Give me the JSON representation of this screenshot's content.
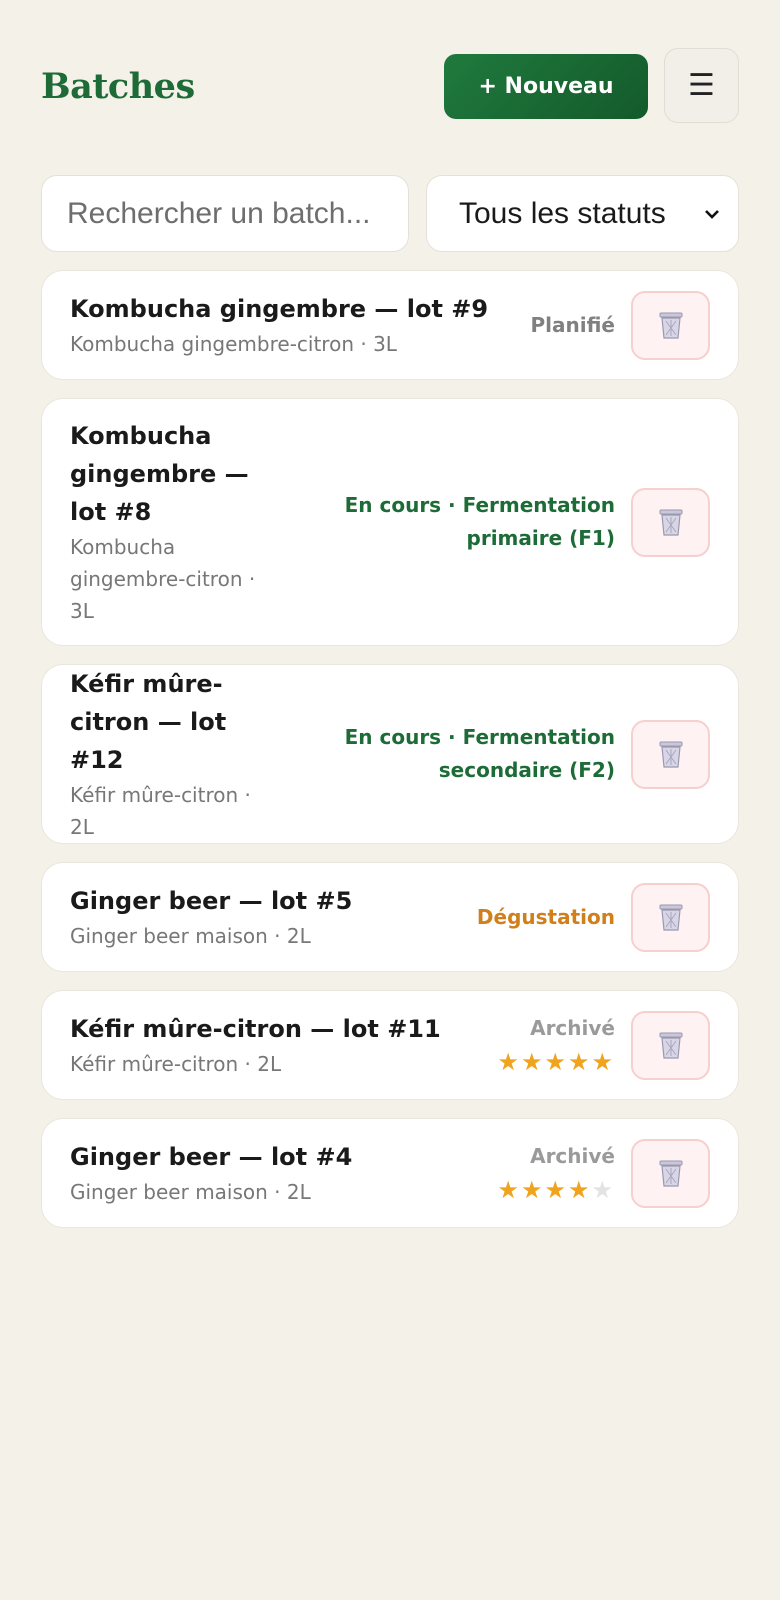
{
  "header": {
    "title": "Batches",
    "new_button": "+ Nouveau",
    "menu_icon": "☰"
  },
  "filters": {
    "search_placeholder": "Rechercher un batch...",
    "status_value": "Tous les statuts",
    "chevron": "⌄"
  },
  "colors": {
    "brand_green": "#1d6b36",
    "tasting_orange": "#d17f1a",
    "star": "#f0a31c"
  },
  "batches": [
    {
      "name": "Kombucha gingembre — lot #9",
      "meta": "Kombucha gingembre-citron · 3L",
      "status": "Planifié",
      "rating": null
    },
    {
      "name": "Kombucha gingembre — lot #8",
      "meta": "Kombucha gingembre-citron · 3L",
      "status": "En cours · Fermentation primaire (F1)",
      "rating": null
    },
    {
      "name": "Kéfir mûre-citron — lot #12",
      "meta": "Kéfir mûre-citron · 2L",
      "status": "En cours · Fermentation secondaire (F2)",
      "rating": null
    },
    {
      "name": "Ginger beer — lot #5",
      "meta": "Ginger beer maison · 2L",
      "status": "Dégustation",
      "rating": null
    },
    {
      "name": "Kéfir mûre-citron — lot #11",
      "meta": "Kéfir mûre-citron · 2L",
      "status": "Archivé",
      "rating": 5
    },
    {
      "name": "Ginger beer — lot #4",
      "meta": "Ginger beer maison · 2L",
      "status": "Archivé",
      "rating": 4
    }
  ]
}
